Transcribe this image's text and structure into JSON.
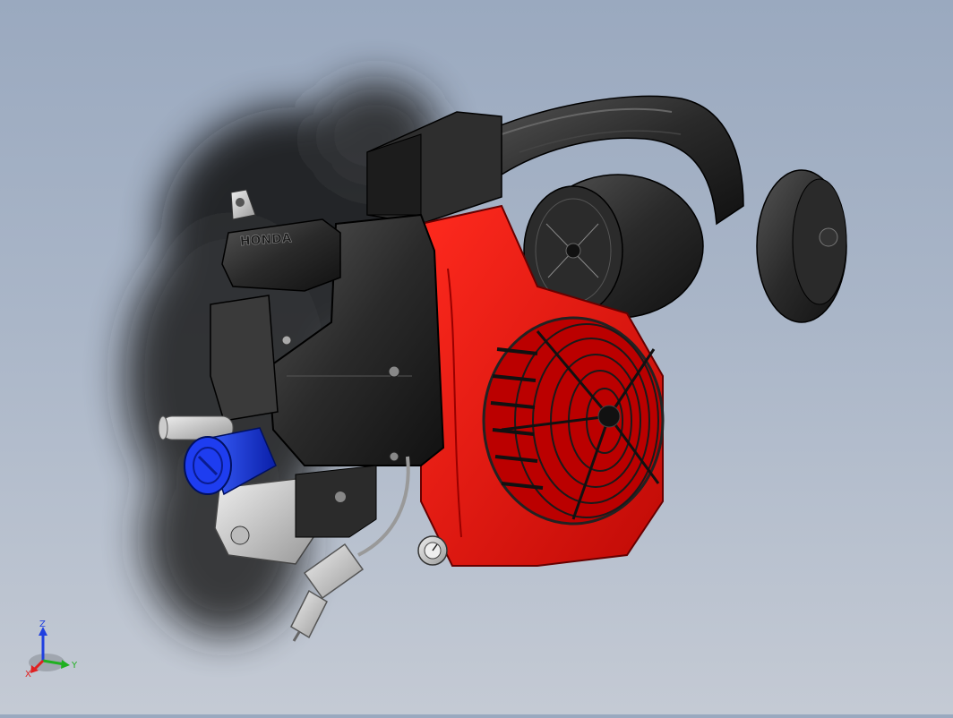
{
  "viewport": {
    "background_top": "#9aa9bf",
    "background_bottom": "#c4cad4",
    "model": {
      "brand_label": "HONDA",
      "shroud_color": "#e8140f",
      "body_color": "#2a2a2a",
      "filter_color": "#1a3ee0",
      "metal_color": "#cfcfcf"
    }
  },
  "triad": {
    "x_label": "X",
    "y_label": "Y",
    "z_label": "Z",
    "x_color": "#e02020",
    "y_color": "#20b020",
    "z_color": "#2040e0"
  }
}
